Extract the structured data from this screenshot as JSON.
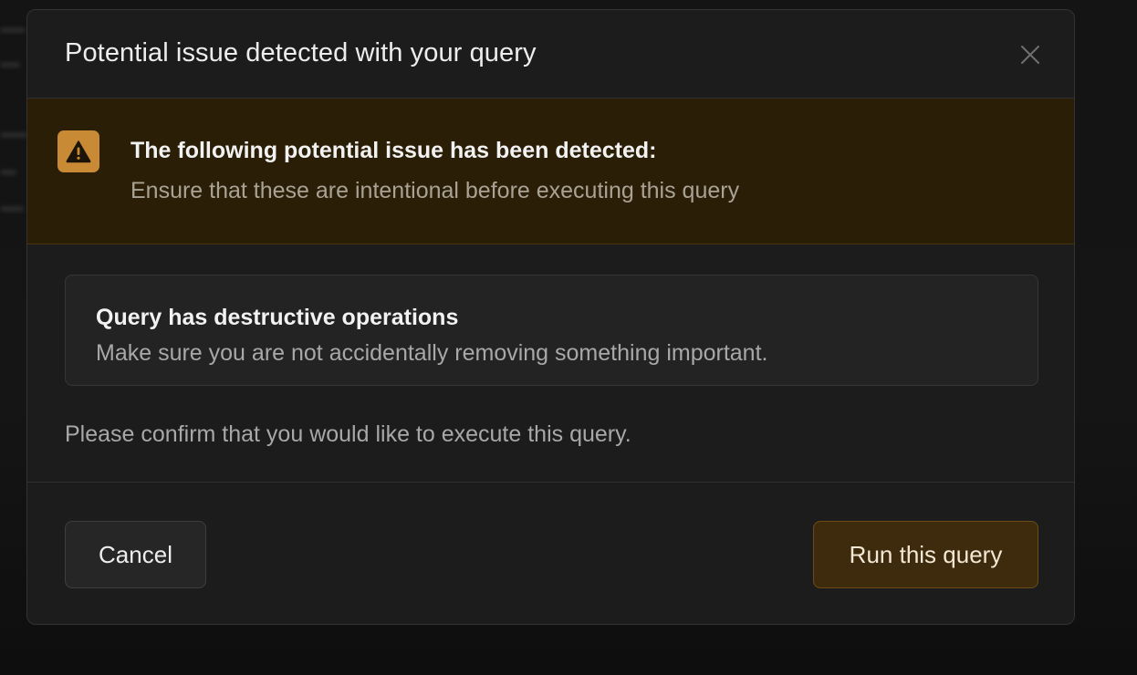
{
  "modal": {
    "title": "Potential issue detected with your query",
    "close_icon": "close-icon"
  },
  "warning": {
    "icon": "warning-triangle-icon",
    "title": "The following potential issue has been detected:",
    "description": "Ensure that these are intentional before executing this query",
    "colors": {
      "banner_bg": "#2b1e07",
      "icon_bg": "#c98a36"
    }
  },
  "issue": {
    "title": "Query has destructive operations",
    "description": "Make sure you are not accidentally removing something important."
  },
  "confirm_text": "Please confirm that you would like to execute this query.",
  "footer": {
    "cancel_label": "Cancel",
    "run_label": "Run this query",
    "colors": {
      "run_bg": "#3e2a0c",
      "run_border": "#6e4c16"
    }
  }
}
